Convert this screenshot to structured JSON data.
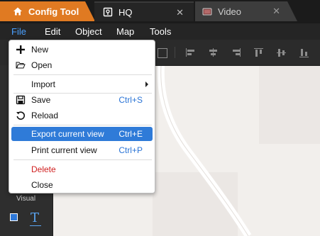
{
  "tabs": {
    "config": {
      "label": "Config Tool",
      "icon": "home-icon"
    },
    "hq": {
      "label": "HQ",
      "icon": "map-doc-icon"
    },
    "video": {
      "label": "Video",
      "icon": "video-icon"
    }
  },
  "menubar": {
    "file": "File",
    "edit": "Edit",
    "object": "Object",
    "map": "Map",
    "tools": "Tools"
  },
  "file_menu": {
    "new": {
      "label": "New",
      "icon": "plus-icon"
    },
    "open": {
      "label": "Open",
      "icon": "folder-open-icon"
    },
    "import": {
      "label": "Import",
      "icon": "submenu-arrow-icon"
    },
    "save": {
      "label": "Save",
      "shortcut": "Ctrl+S",
      "icon": "floppy-disk-icon"
    },
    "reload": {
      "label": "Reload",
      "icon": "reload-icon"
    },
    "export_view": {
      "label": "Export current view",
      "shortcut": "Ctrl+E"
    },
    "print_view": {
      "label": "Print current view",
      "shortcut": "Ctrl+P"
    },
    "delete": {
      "label": "Delete"
    },
    "close": {
      "label": "Close"
    }
  },
  "left_panel": {
    "visual_label": "Visual",
    "text_tool_glyph": "T"
  },
  "colors": {
    "accent_orange": "#e07a22",
    "accent_blue": "#2f7bd8",
    "danger_red": "#d02020"
  }
}
